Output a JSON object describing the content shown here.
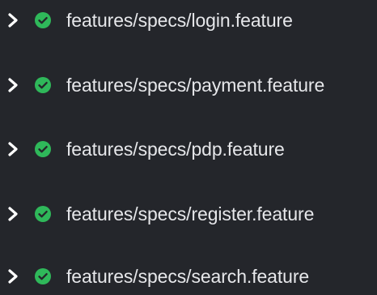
{
  "status_color": "#2fb85a",
  "feature_files": [
    {
      "path": "features/specs/login.feature",
      "status": "passed",
      "expand_icon": "chevron-right-icon",
      "status_icon": "check-circle-icon"
    },
    {
      "path": "features/specs/payment.feature",
      "status": "passed",
      "expand_icon": "chevron-right-icon",
      "status_icon": "check-circle-icon"
    },
    {
      "path": "features/specs/pdp.feature",
      "status": "passed",
      "expand_icon": "chevron-right-icon",
      "status_icon": "check-circle-icon"
    },
    {
      "path": "features/specs/register.feature",
      "status": "passed",
      "expand_icon": "chevron-right-icon",
      "status_icon": "check-circle-icon"
    },
    {
      "path": "features/specs/search.feature",
      "status": "passed",
      "expand_icon": "chevron-right-icon",
      "status_icon": "check-circle-icon"
    }
  ]
}
